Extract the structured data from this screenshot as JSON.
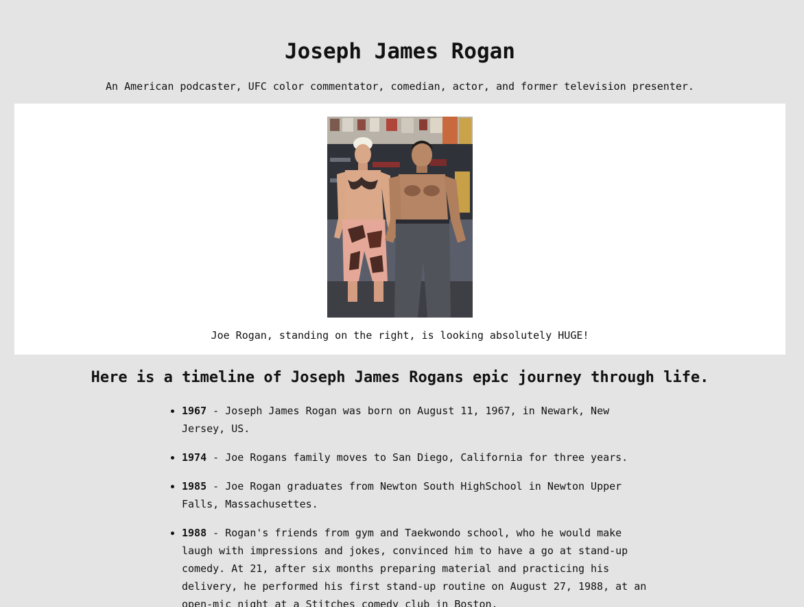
{
  "header": {
    "title": "Joseph James Rogan",
    "subtitle": "An American podcaster, UFC color commentator, comedian, actor, and former television presenter."
  },
  "figure": {
    "image_alt": "Photo of two shirtless men posing in a gym",
    "caption": "Joe Rogan, standing on the right, is looking absolutely HUGE!"
  },
  "timeline": {
    "heading": "Here is a timeline of Joseph James Rogans epic journey through life.",
    "items": [
      {
        "year": "1967",
        "text": " - Joseph James Rogan was born on August 11, 1967, in Newark, New Jersey, US."
      },
      {
        "year": "1974",
        "text": " - Joe Rogans family moves to San Diego, California for three years."
      },
      {
        "year": "1985",
        "text": " - Joe Rogan graduates from Newton South HighSchool in Newton Upper Falls, Massachusettes."
      },
      {
        "year": "1988",
        "text": " - Rogan's friends from gym and Taekwondo school, who he would make laugh with impressions and jokes, convinced him to have a go at stand-up comedy. At 21, after six months preparing material and practicing his delivery, he performed his first stand-up routine on August 27, 1988, at an open-mic night at a Stitches comedy club in Boston."
      }
    ]
  }
}
